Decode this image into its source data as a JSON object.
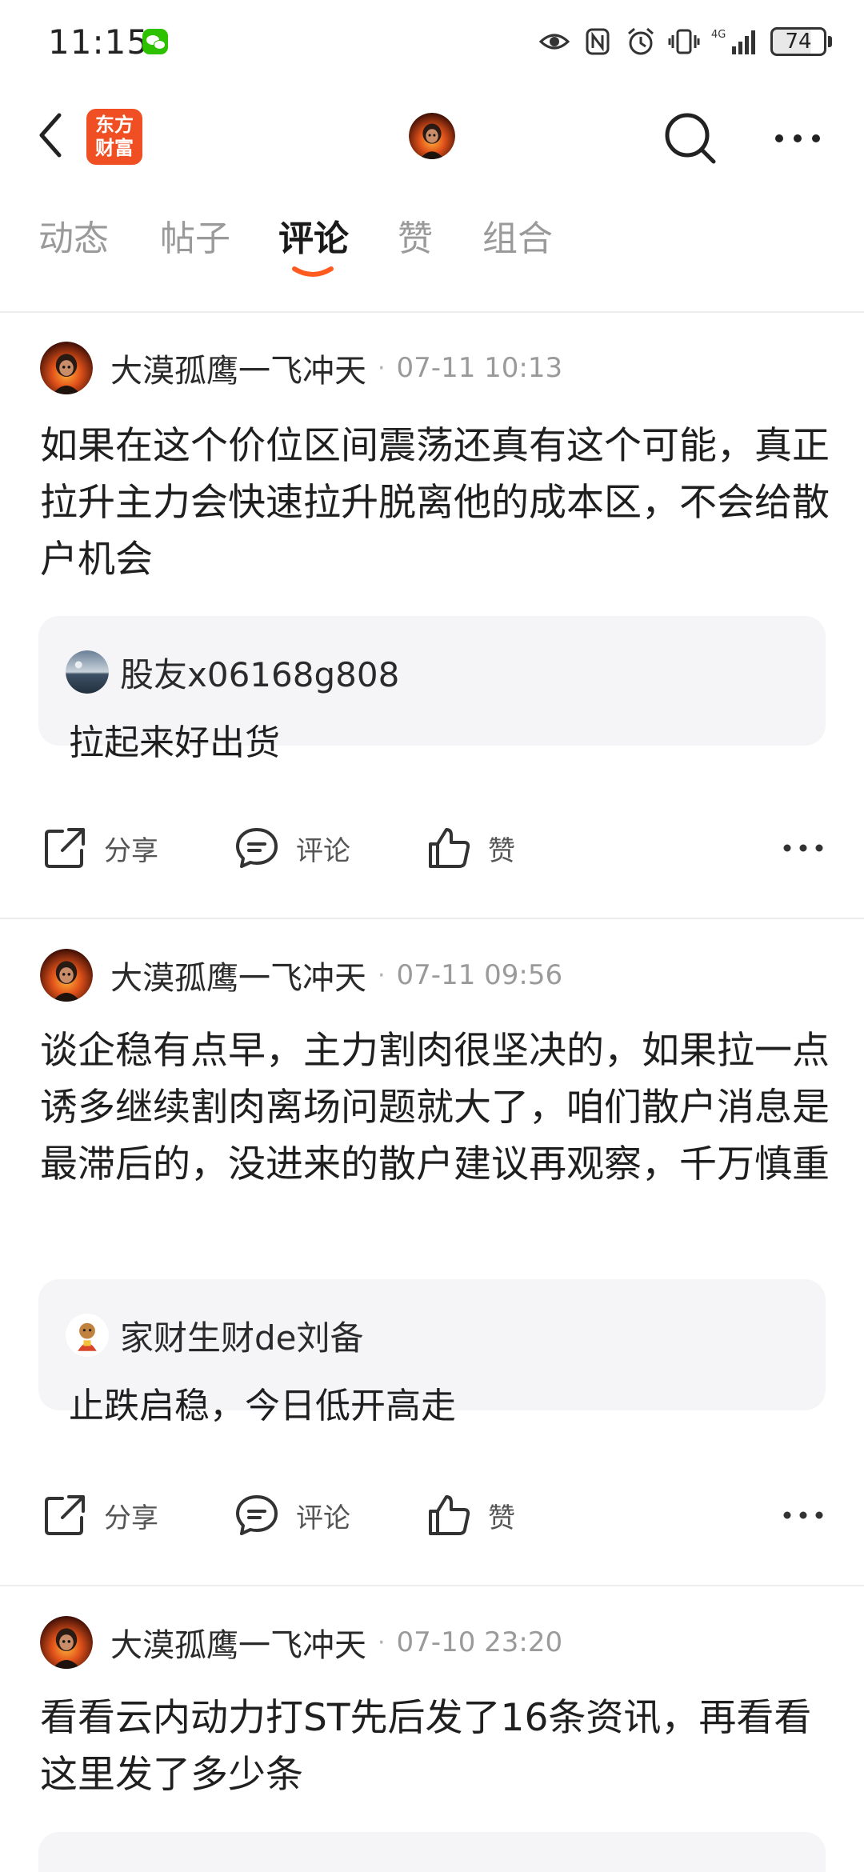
{
  "status_bar": {
    "time": "11:15",
    "network": "4G",
    "battery": "74",
    "icons": [
      "wechat-icon",
      "eye-icon",
      "nfc-icon",
      "alarm-icon",
      "vibrate-icon",
      "signal-icon",
      "battery-icon"
    ]
  },
  "header": {
    "logo_line1": "东方",
    "logo_line2": "财富",
    "brand_color": "#f04e23",
    "icons": [
      "back-icon",
      "search-icon",
      "more-icon"
    ]
  },
  "tabs": [
    {
      "label": "动态",
      "active": false
    },
    {
      "label": "帖子",
      "active": false
    },
    {
      "label": "评论",
      "active": true
    },
    {
      "label": "赞",
      "active": false
    },
    {
      "label": "组合",
      "active": false
    }
  ],
  "accent_color": "#ff5a1f",
  "posts": [
    {
      "author": "大漠孤鹰一飞冲天",
      "time": "07-11 10:13",
      "text": "如果在这个价位区间震荡还真有这个可能，真正拉升主力会快速拉升脱离他的成本区，不会给散户机会",
      "quote": {
        "user": "股友x06168g808",
        "text": "拉起来好出货"
      }
    },
    {
      "author": "大漠孤鹰一飞冲天",
      "time": "07-11 09:56",
      "text": "谈企稳有点早，主力割肉很坚决的，如果拉一点诱多继续割肉离场问题就大了，咱们散户消息是最滞后的，没进来的散户建议再观察，千万慎重",
      "quote": {
        "user": "家财生财de刘备",
        "text": "止跌启稳，今日低开高走"
      }
    },
    {
      "author": "大漠孤鹰一飞冲天",
      "time": "07-10 23:20",
      "text": "看看云内动力打ST先后发了16条资讯，再看看这里发了多少条"
    }
  ],
  "actions": {
    "share": "分享",
    "comment": "评论",
    "like": "赞"
  }
}
